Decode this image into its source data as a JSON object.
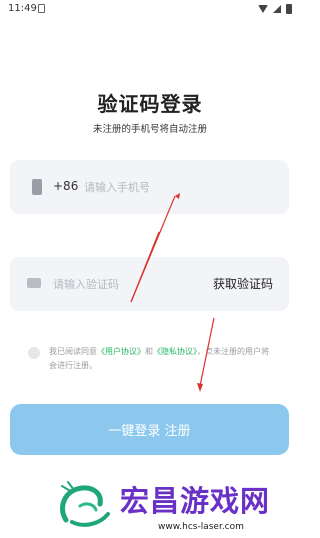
{
  "status": {
    "time": "11:49"
  },
  "login": {
    "title": "验证码登录",
    "subtitle": "未注册的手机号将自动注册",
    "phone": {
      "country_code": "+86",
      "placeholder": "请输入手机号"
    },
    "code": {
      "placeholder": "请输入验证码",
      "get_code_label": "获取验证码"
    },
    "agreement": {
      "prefix": "我已阅读同意",
      "user_agreement": "《用户协议》",
      "and": "和",
      "privacy_policy": "《隐私协议》",
      "suffix": "，点未注册的用户将会进行注册。"
    },
    "submit_label": "一键登录 注册"
  },
  "watermark": {
    "name": "宏昌游戏网",
    "url": "www.hcs-laser.com"
  },
  "colors": {
    "button": "#8cc8ee",
    "link": "#27b866",
    "annotation": "#d9342b",
    "watermark": "#6a31c6"
  }
}
